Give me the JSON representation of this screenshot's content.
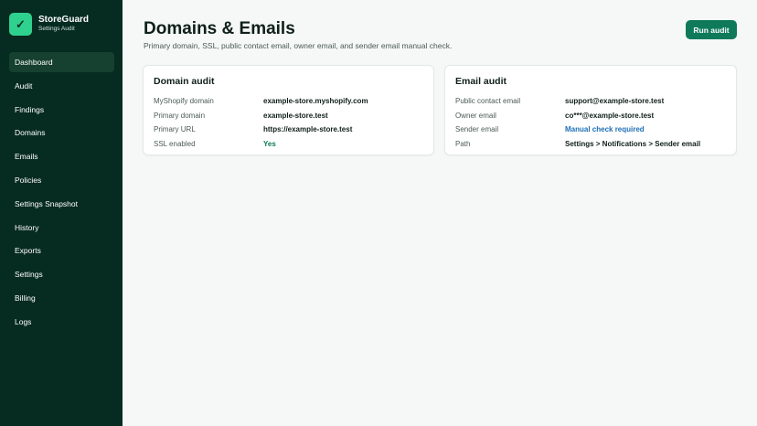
{
  "brand": {
    "name": "StoreGuard",
    "subtitle": "Settings Audit",
    "logo_icon": "check-icon",
    "accent": "#2fd18f"
  },
  "nav": {
    "items": [
      {
        "label": "Dashboard",
        "active": true
      },
      {
        "label": "Audit"
      },
      {
        "label": "Findings"
      },
      {
        "label": "Domains"
      },
      {
        "label": "Emails"
      },
      {
        "label": "Policies"
      },
      {
        "label": "Settings Snapshot"
      },
      {
        "label": "History"
      },
      {
        "label": "Exports"
      },
      {
        "label": "Settings"
      },
      {
        "label": "Billing"
      },
      {
        "label": "Logs"
      }
    ]
  },
  "header": {
    "title": "Domains & Emails",
    "subtitle": "Primary domain, SSL, public contact email, owner email, and sender email manual check.",
    "run_button": "Run audit"
  },
  "domain_audit": {
    "title": "Domain audit",
    "rows": [
      {
        "label": "MyShopify domain",
        "value": "example-store.myshopify.com"
      },
      {
        "label": "Primary domain",
        "value": "example-store.test"
      },
      {
        "label": "Primary URL",
        "value": "https://example-store.test"
      },
      {
        "label": "SSL enabled",
        "value": "Yes"
      }
    ]
  },
  "email_audit": {
    "title": "Email audit",
    "rows": [
      {
        "label": "Public contact email",
        "value": "support@example-store.test"
      },
      {
        "label": "Owner email",
        "value": "co***@example-store.test"
      },
      {
        "label": "Sender email",
        "value": "Manual check required"
      },
      {
        "label": "Path",
        "value": "Settings > Notifications > Sender email"
      }
    ]
  },
  "colors": {
    "sidebar": "#062b20",
    "primary_button": "#0e7a5a",
    "success": "#0e7a5a",
    "link": "#1e6fb5"
  }
}
